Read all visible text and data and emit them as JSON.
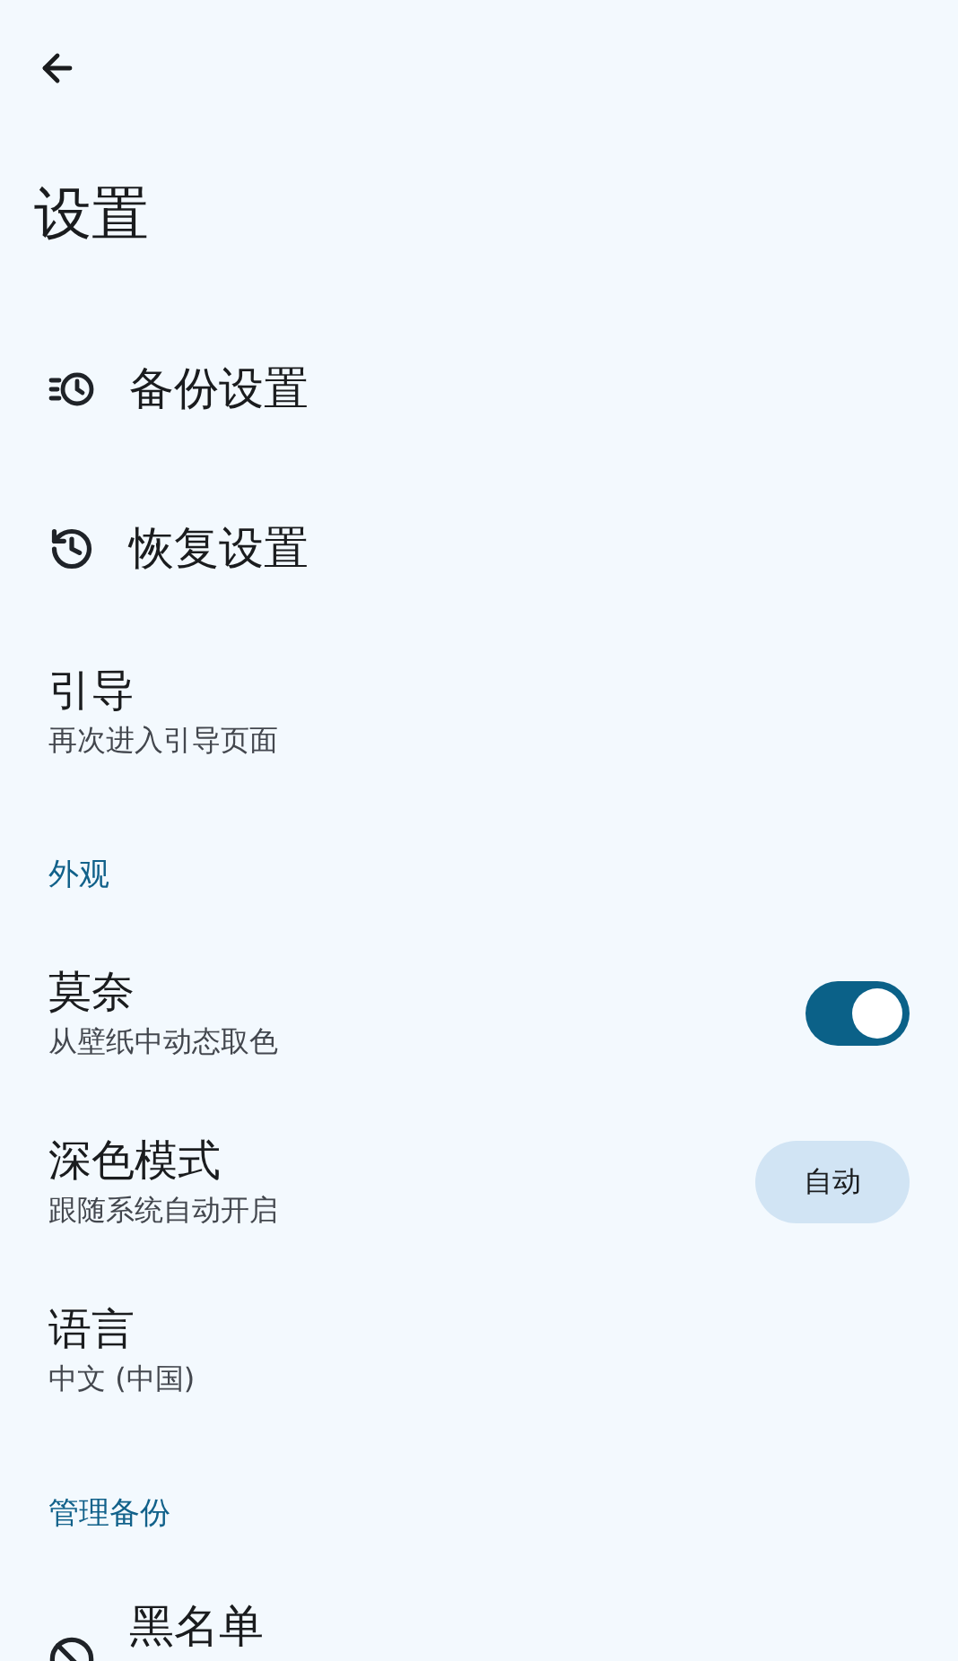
{
  "title": "设置",
  "items": [
    {
      "kind": "icon",
      "title": "备份设置"
    },
    {
      "kind": "icon",
      "title": "恢复设置"
    },
    {
      "kind": "text",
      "title": "引导",
      "subtitle": "再次进入引导页面"
    },
    {
      "kind": "section",
      "title": "外观"
    },
    {
      "kind": "switch",
      "title": "莫奈",
      "subtitle": "从壁纸中动态取色",
      "on": true
    },
    {
      "kind": "button",
      "title": "深色模式",
      "subtitle": "跟随系统自动开启",
      "button": "自动"
    },
    {
      "kind": "text",
      "title": "语言",
      "subtitle": "中文 (中国)"
    },
    {
      "kind": "section",
      "title": "管理备份"
    },
    {
      "kind": "icon",
      "title": "黑名单"
    }
  ]
}
